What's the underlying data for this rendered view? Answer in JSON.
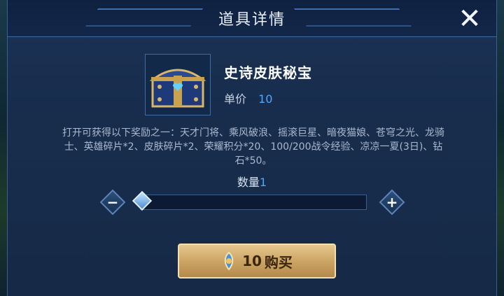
{
  "dialog": {
    "title": "道具详情",
    "close_label": "✕"
  },
  "item": {
    "name": "史诗皮肤秘宝",
    "price_label": "单价",
    "price_value": "10",
    "icon": "treasure-chest-icon"
  },
  "description": "打开可获得以下奖励之一：天才门将、乘风破浪、摇滚巨星、暗夜猫娘、苍穹之光、龙骑士、英雄碎片*2、皮肤碎片*2、荣耀积分*20、100/200战令经验、凉凉一夏(3日)、钻石*50。",
  "quantity": {
    "label": "数量",
    "value": "1",
    "minus_label": "−",
    "plus_label": "+",
    "slider_fraction": 0
  },
  "buy_button": {
    "amount": "10",
    "label": "购买",
    "icon": "coupon-icon"
  },
  "colors": {
    "accent_blue": "#4da6ff",
    "button_gold": "#c9a261"
  }
}
